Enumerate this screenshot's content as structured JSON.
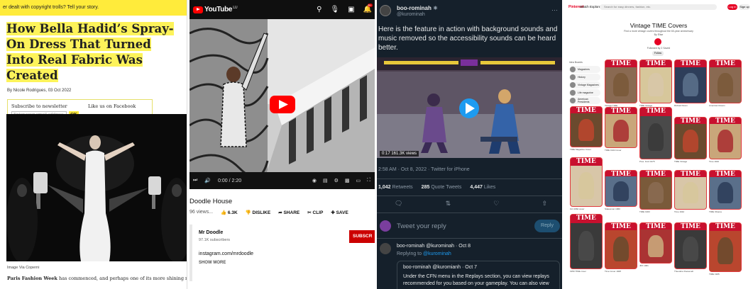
{
  "article": {
    "banner": "er dealt with copyright trolls? Tell your story.",
    "headline": "How Bella Hadid’s Spray-On Dress That Turned Into Real Fabric Was Created",
    "byline": "By Nicole Rodrigues, 03 Oct 2022",
    "newsletter_label": "Subscribe to newsletter",
    "facebook_label": "Like us on Facebook",
    "email_placeholder": "Enter your email address",
    "ok_label": "OK",
    "image_caption": "Image Via Coperni",
    "body_bold": "Paris Fashion Week",
    "body_text": " has commenced, and perhaps one of its more shining moments—s"
  },
  "youtube": {
    "logo": "YouTube",
    "region": "LU",
    "time": "0:00 / 2:20",
    "title": "Doodle House",
    "views": "96 views...",
    "likes": "6.3K",
    "dislike": "DISLIKE",
    "share": "SHARE",
    "clip": "CLIP",
    "save": "SAVE",
    "channel": "Mr Doodle",
    "subscribers": "97.1K subscribers",
    "subscribe": "SUBSCR",
    "link": "instagram.com/mrdoodle",
    "show_more": "SHOW MORE",
    "notif_count": "9+"
  },
  "twitter": {
    "name": "boo-rominah",
    "handle": "@kurominah",
    "text": "Here is the feature in action with background sounds and music removed so the accessibility sounds can be heard better.",
    "video_badge": "0:17  161.3K views",
    "meta": "2:58 AM · Oct 8, 2022 · Twitter for iPhone",
    "retweets_n": "1,042",
    "retweets_l": "Retweets",
    "quotes_n": "285",
    "quotes_l": "Quote Tweets",
    "likes_n": "4,447",
    "likes_l": "Likes",
    "reply_placeholder": "Tweet your reply",
    "reply_button": "Reply",
    "reply_author": "boo-rominah @kurominah · Oct 8",
    "replying_to_prefix": "Replying to ",
    "replying_to_handle": "@kurominah",
    "quote_author": "boo-rominah @kuromianh · Oct 7",
    "quote_text": "Under the CFN menu in the Replays section, you can view replays recommended for you based on your gameplay. You can also view"
  },
  "pinterest": {
    "logo": "Pinterest",
    "nav_watch": "Watch",
    "nav_explore": "Explore",
    "search_placeholder": "Search for easy dinners, fashion, etc.",
    "login": "Log in",
    "signup": "Sign up",
    "board_title": "Vintage TIME Covers",
    "board_sub": "Find a more vintage covers throughout the 60-year anniversary",
    "board_sub2": "By Elise",
    "followers": "Followed by 2 Saved",
    "follow_btn": "Follow",
    "side_header": "Idea Boards",
    "categories": [
      "Magazines",
      "History",
      "Vintage Magazines",
      "Life magazine",
      "American Presidents"
    ],
    "masthead": "TIME",
    "pin_labels": [
      "TIME Magazine Cover",
      "Oct 1962 cover",
      "1950 TIME cover",
      "Vintage TIME",
      "TIME 1944 Cover",
      "Statesman 1960",
      "Time Cover 1928",
      "TIME Vintage",
      "Pres. Ford 1975",
      "TIME 1963",
      "JFK 1961",
      "Richard Nixon",
      "TIME Vintage",
      "Time 1942",
      "Theodore Roosevelt",
      "American Dream",
      "Time 1942",
      "TIME Obama",
      "TIME 1965",
      "TIME 1962",
      "Ronald Reagan",
      "TIME Choice"
    ]
  }
}
